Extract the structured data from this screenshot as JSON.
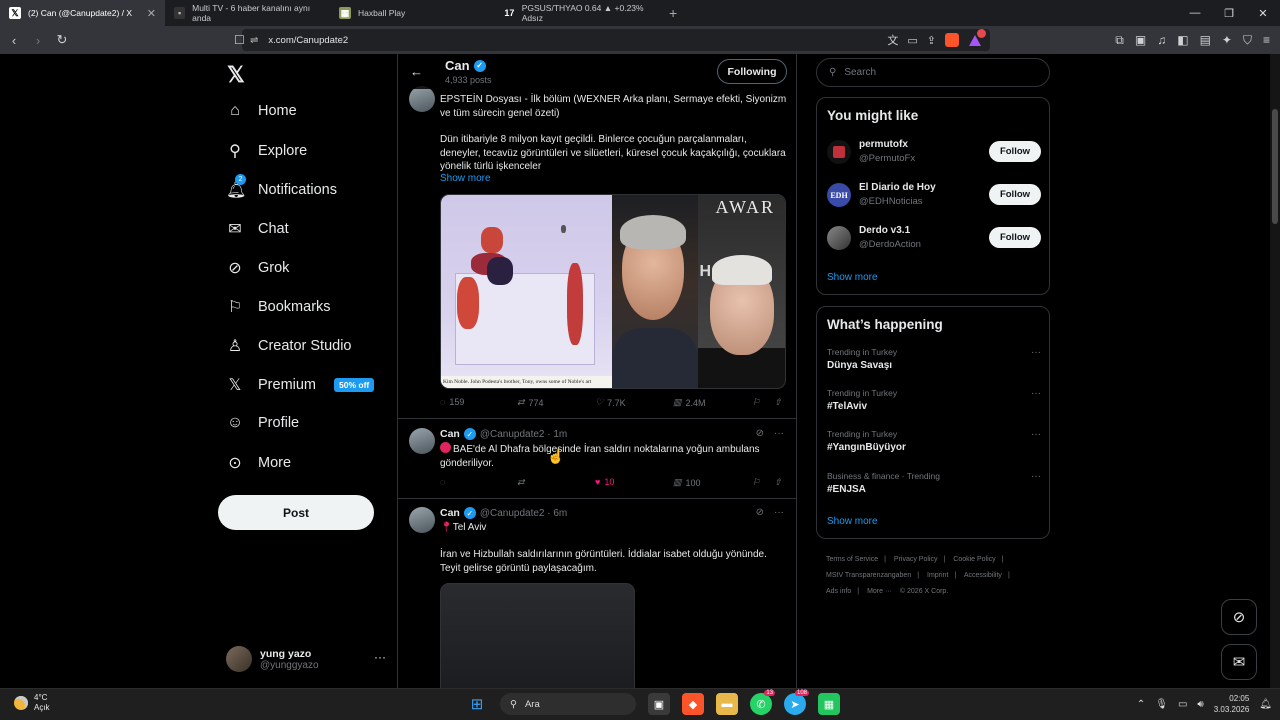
{
  "browser": {
    "tabs": [
      {
        "title": "(2) Can (@Canupdate2) / X",
        "icon": "x-icon",
        "close": "✕"
      },
      {
        "title": "Multi TV - 6 haber kanalını aynı anda",
        "icon": "tv-icon"
      },
      {
        "title": "Haxball Play",
        "icon": "haxball-icon"
      },
      {
        "title": "PGSUS/THYAO 0.64 ▲ +0.23% Adsız",
        "icon": "tradingview-icon"
      }
    ],
    "new_tab": "+",
    "url": "x.com/Canupdate2",
    "rewards_count": ""
  },
  "sidebar": {
    "logo": "𝕏",
    "items": [
      {
        "label": "Home",
        "icon": "home-icon"
      },
      {
        "label": "Explore",
        "icon": "search-icon"
      },
      {
        "label": "Notifications",
        "icon": "bell-icon",
        "badge": "2"
      },
      {
        "label": "Chat",
        "icon": "mail-icon"
      },
      {
        "label": "Grok",
        "icon": "grok-icon"
      },
      {
        "label": "Bookmarks",
        "icon": "bookmark-icon"
      },
      {
        "label": "Creator Studio",
        "icon": "creator-icon"
      },
      {
        "label": "Premium",
        "icon": "x-icon",
        "badge": "50% off"
      },
      {
        "label": "Profile",
        "icon": "person-icon"
      },
      {
        "label": "More",
        "icon": "more-circle-icon"
      }
    ],
    "post_label": "Post",
    "account": {
      "name": "yung yazo",
      "handle": "@yunggyazo"
    }
  },
  "profile_header": {
    "name": "Can",
    "posts": "4,933 posts",
    "following_label": "Following"
  },
  "tweets": [
    {
      "text_1": "EPSTEİN Dosyası - İlk bölüm (WEXNER Arka planı, Sermaye efekti, Siyonizm ve tüm sürecin genel özeti)",
      "text_2": "Dün itibariyle 8 milyon kayıt geçildi. Binlerce çocuğun parçalanmaları, deneyler, tecavüz görüntüleri ve silüetleri, küresel çocuk kaçakçılığı, çocuklara yönelik türlü işkenceler",
      "show_more": "Show more",
      "image_caption": "Kim Noble. John Podesta's brother, Tony, owns some of Noble's art",
      "image_text_right": "AWAR",
      "image_text_right2": "H",
      "replies": "159",
      "reposts": "774",
      "likes": "7.7K",
      "views": "2.4M"
    },
    {
      "name": "Can",
      "handle": "@Canupdate2 · 1m",
      "text": "BAE'de Al Dhafra bölgesinde İran saldırı noktalarına yoğun ambulans gönderiliyor.",
      "replies": "",
      "reposts": "",
      "likes": "10",
      "views": "100"
    },
    {
      "name": "Can",
      "handle": "@Canupdate2 · 6m",
      "line1": "Tel Aviv",
      "text": "İran ve Hizbullah saldırılarının görüntüleri. İddialar isabet olduğu yönünde. Teyit gelirse görüntü paylaşacağım."
    }
  ],
  "right": {
    "search_placeholder": "Search",
    "might_like_title": "You might like",
    "suggestions": [
      {
        "name": "permutofx",
        "handle": "@PermutoFx",
        "avatar_text": ""
      },
      {
        "name": "El Diario de Hoy",
        "handle": "@EDHNoticias",
        "avatar_text": "EDH"
      },
      {
        "name": "Derdo v3.1",
        "handle": "@DerdoAction",
        "avatar_text": ""
      }
    ],
    "follow_label": "Follow",
    "show_more": "Show more",
    "happening_title": "What’s happening",
    "trends": [
      {
        "context": "Trending in Turkey",
        "topic": "Dünya Savaşı"
      },
      {
        "context": "Trending in Turkey",
        "topic": "#TelAviv"
      },
      {
        "context": "Trending in Turkey",
        "topic": "#YangınBüyüyor"
      },
      {
        "context": "Business & finance · Trending",
        "topic": "#ENJSA"
      }
    ],
    "trend_more": "···",
    "footer": [
      "Terms of Service",
      "|",
      "Privacy Policy",
      "|",
      "Cookie Policy",
      "|",
      "MStV Transparenzangaben",
      "|",
      "Imprint",
      "|",
      "Accessibility",
      "|",
      "Ads info",
      "|",
      "More ···",
      "© 2026 X Corp."
    ]
  },
  "taskbar": {
    "weather_temp": "4°C",
    "weather_text": "Açık",
    "search_label": "Ara",
    "whatsapp_badge": "13",
    "telegram_badge": "108",
    "time": "02:05",
    "date": "3.03.2026"
  },
  "colors": {
    "accent": "#1d9bf0",
    "like": "#f91880",
    "bg": "#000000",
    "border": "#2f3336"
  }
}
